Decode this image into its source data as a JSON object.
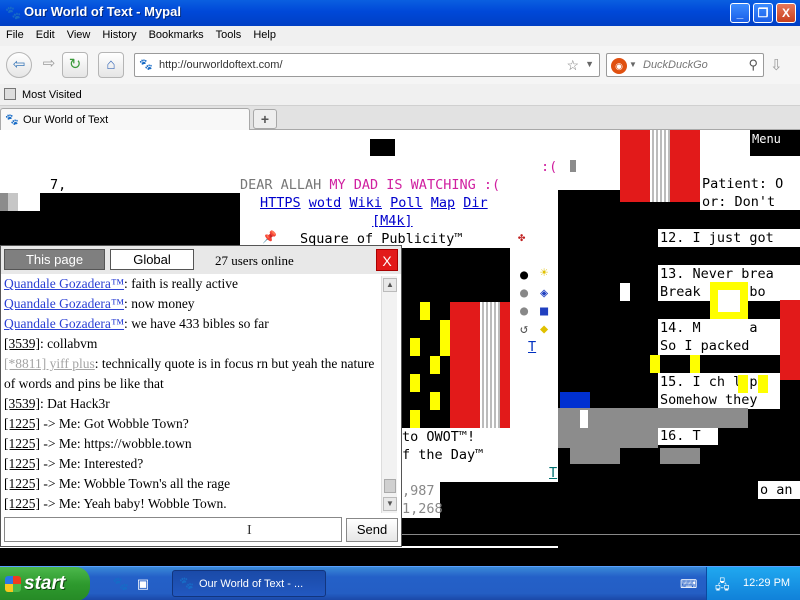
{
  "window": {
    "title": "Our World of Text - Mypal",
    "min": "_",
    "max": "❐",
    "close": "X"
  },
  "menu": [
    "File",
    "Edit",
    "View",
    "History",
    "Bookmarks",
    "Tools",
    "Help"
  ],
  "nav": {
    "url": "http://ourworldoftext.com/",
    "search_placeholder": "DuckDuckGo"
  },
  "bookmarks": {
    "most_visited": "Most Visited"
  },
  "tab": {
    "label": "Our World of Text",
    "new": "+"
  },
  "page": {
    "menu_label": "Menu",
    "row_frown1": ":(",
    "row_seven": "7,",
    "row_dear": [
      "DEAR ALLAH ",
      "MY DAD IS WATCHING",
      " :("
    ],
    "links": [
      "HTTPS",
      "wotd",
      "Wiki",
      "Poll",
      "Map",
      "Dir"
    ],
    "m4k": "[M4k]",
    "publicity": "Square of Publicity™",
    "patient": "Patient: O",
    "or_dont": "or: Don't",
    "l12": "12. I just got",
    "l13": "13. Never brea",
    "break": "Break    r bo",
    "l14a": "14. M      a",
    "l14b": "So I packed",
    "l15a": "15. I ch l p",
    "l15b": "Somehow they",
    "l16": "16. T",
    "owot": "to OWOT™!",
    "day": "f the Day™",
    "t1": "T",
    "t2": "T",
    "n987": ",987",
    "n268": "1,268",
    "o_an": "o an"
  },
  "chat": {
    "tab_this": "This page",
    "tab_global": "Global",
    "online": "27 users online",
    "close": "X",
    "send": "Send",
    "messages": [
      {
        "nick": "Quandale Gozadera™",
        "sep": ": ",
        "text": "faith is really active",
        "style": "nick"
      },
      {
        "nick": "Quandale Gozadera™",
        "sep": ": ",
        "text": "now money",
        "style": "nick"
      },
      {
        "nick": "Quandale Gozadera™",
        "sep": ": ",
        "text": "we have 433 bibles so far",
        "style": "nick"
      },
      {
        "nick": "[3539]",
        "sep": ": ",
        "text": "collabvm",
        "style": "id"
      },
      {
        "nick": "[*8811] yiff plus",
        "sep": ": ",
        "text": "technically quote is in focus rn but yeah the nature of words and pins be like that",
        "style": "faint"
      },
      {
        "nick": "[3539]",
        "sep": ": ",
        "text": "Dat Hack3r",
        "style": "id"
      },
      {
        "nick": "[1225]",
        "sep": " -> Me: ",
        "text": "Got Wobble Town?",
        "style": "id"
      },
      {
        "nick": "[1225]",
        "sep": " -> Me: ",
        "text": "https://wobble.town",
        "style": "id"
      },
      {
        "nick": "[1225]",
        "sep": " -> Me: ",
        "text": "Interested?",
        "style": "id"
      },
      {
        "nick": "[1225]",
        "sep": " -> Me: ",
        "text": "Wobble Town's all the rage",
        "style": "id"
      },
      {
        "nick": "[1225]",
        "sep": " -> Me: ",
        "text": "Yeah baby! Wobble Town.",
        "style": "id"
      }
    ]
  },
  "taskbar": {
    "start": "start",
    "task_label": "Our World of Text - ...",
    "clock": "12:29 PM"
  }
}
